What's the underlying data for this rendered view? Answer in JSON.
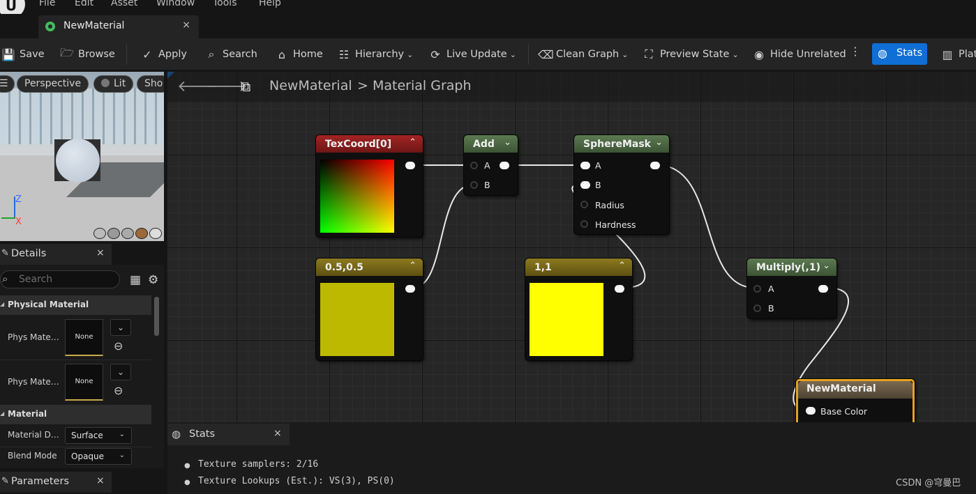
{
  "menu": [
    "File",
    "Edit",
    "Asset",
    "Window",
    "Tools",
    "Help"
  ],
  "doc_tab": {
    "label": "NewMaterial",
    "close": "×"
  },
  "toolbar": {
    "save": "Save",
    "browse": "Browse",
    "apply": "Apply",
    "search": "Search",
    "home": "Home",
    "hierarchy": "Hierarchy",
    "live_update": "Live Update",
    "clean_graph": "Clean Graph",
    "preview_state": "Preview State",
    "hide_unrelated": "Hide Unrelated",
    "stats": "Stats",
    "platform": "Plat",
    "accent": "#0f6fd6"
  },
  "viewport": {
    "menu_glyph": "☰",
    "perspective": "Perspective",
    "lit": "Lit",
    "show": "Sho",
    "axis_z": "Z",
    "axis_x": "X"
  },
  "details": {
    "title": "Details",
    "close": "×",
    "search_placeholder": "Search",
    "categories": {
      "physical_material": "Physical Material",
      "material": "Material"
    },
    "props": {
      "phys1_label": "Phys Mate…",
      "phys1_value": "None",
      "phys2_label": "Phys Mate…",
      "phys2_value": "None",
      "domain_label": "Material D…",
      "domain_value": "Surface",
      "blend_label": "Blend Mode",
      "blend_value": "Opaque"
    }
  },
  "parameters": {
    "title": "Parameters",
    "close": "×"
  },
  "graph": {
    "breadcrumb_root": "NewMaterial",
    "breadcrumb_sep": ">",
    "breadcrumb_leaf": "Material Graph",
    "nodes": {
      "texcoord": {
        "title": "TexCoord[0]",
        "color": "#8c1c1c"
      },
      "add": {
        "title": "Add",
        "pin_a": "A",
        "pin_b": "B",
        "color": "#4d6a45"
      },
      "spheremask": {
        "title": "SphereMask",
        "pin_a": "A",
        "pin_b": "B",
        "pin_radius": "Radius",
        "pin_hardness": "Hardness",
        "color": "#4d6a45"
      },
      "const2a": {
        "title": "0.5,0.5",
        "color": "#7a6a1a",
        "swatch": "#bdb900"
      },
      "const2b": {
        "title": "1,1",
        "color": "#7a6a1a",
        "swatch": "#ffff00"
      },
      "multiply": {
        "title": "Multiply(,1)",
        "pin_a": "A",
        "pin_b": "B",
        "color": "#4d6a45"
      },
      "result": {
        "title": "NewMaterial",
        "pin_base_color": "Base Color",
        "color": "#6b5a40",
        "border": "#e6a21e"
      }
    }
  },
  "stats": {
    "title": "Stats",
    "close": "×",
    "lines": [
      "Texture samplers: 2/16",
      "Texture Lookups (Est.): VS(3), PS(0)"
    ]
  },
  "watermark": "CSDN @穹曼巴"
}
